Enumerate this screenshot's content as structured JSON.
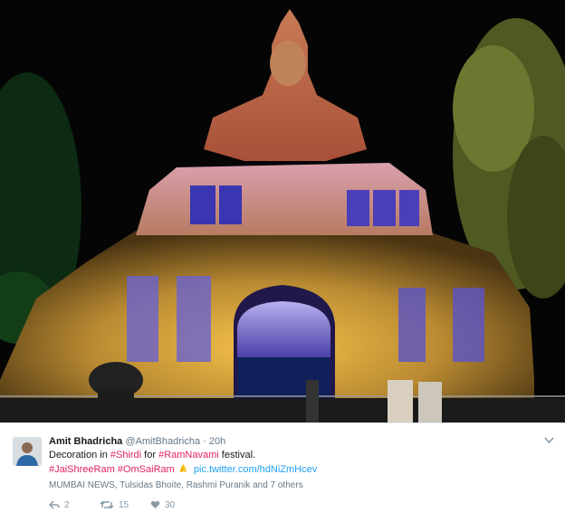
{
  "tweet": {
    "author_name": "Amit Bhadricha",
    "handle": "@AmitBhadricha",
    "separator": "·",
    "time": "20h",
    "text_1": "Decoration in ",
    "hashtag_1": "#Shirdi",
    "text_2": " for ",
    "hashtag_2": "#RamNavami",
    "text_3": " festival.",
    "hashtag_3": "#JaiShreeRam",
    "hashtag_4": "#OmSaiRam",
    "pic_link": "pic.twitter.com/hdNiZmHcev",
    "context": "MUMBAI NEWS, Tulsidas Bhoite, Rashmi Puranik and 7 others",
    "reply_count": "2",
    "retweet_count": "15",
    "like_count": "30"
  },
  "icons": {
    "more": "chevron-down-icon",
    "reply": "reply-icon",
    "retweet": "retweet-icon",
    "like": "heart-icon",
    "emoji": "folded-hands-icon"
  },
  "colors": {
    "hashtag": "#e0245e",
    "link": "#1da1f2",
    "muted": "#657786",
    "text": "#14171a"
  }
}
